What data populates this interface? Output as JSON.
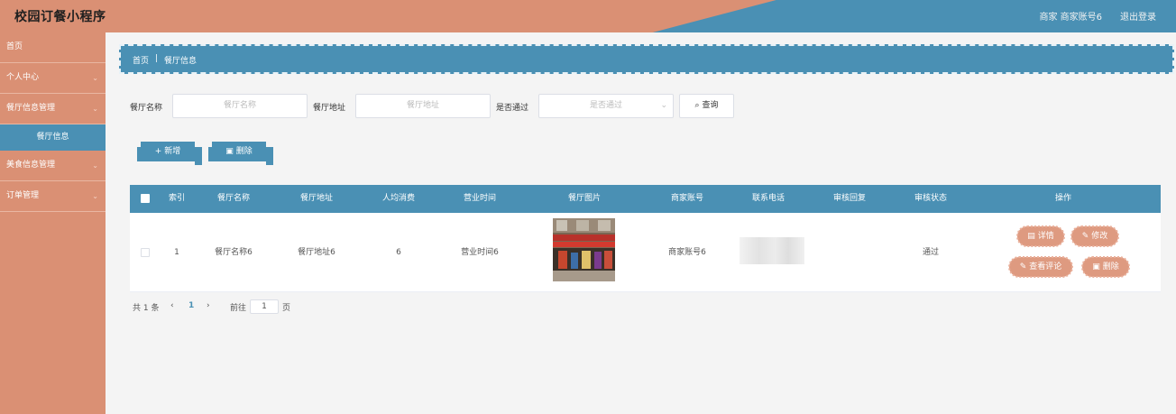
{
  "header": {
    "title": "校园订餐小程序",
    "user": "商家 商家账号6",
    "logout": "退出登录"
  },
  "sidebar": {
    "items": [
      {
        "label": "首页",
        "chevron": ""
      },
      {
        "label": "个人中心",
        "chevron": "⌄"
      },
      {
        "label": "餐厅信息管理",
        "chevron": "⌄"
      },
      {
        "label": "餐厅信息",
        "chevron": ""
      },
      {
        "label": "美食信息管理",
        "chevron": "⌄"
      },
      {
        "label": "订单管理",
        "chevron": "⌄"
      }
    ]
  },
  "breadcrumb": {
    "home": "首页",
    "separator": "|",
    "current": "餐厅信息"
  },
  "search": {
    "name_label": "餐厅名称",
    "name_placeholder": "餐厅名称",
    "address_label": "餐厅地址",
    "address_placeholder": "餐厅地址",
    "pass_label": "是否通过",
    "pass_placeholder": "是否通过",
    "query_label": "查询"
  },
  "actions": {
    "add_label": "新增",
    "delete_label": "删除"
  },
  "table": {
    "headers": [
      "索引",
      "餐厅名称",
      "餐厅地址",
      "人均消费",
      "营业时间",
      "餐厅图片",
      "商家账号",
      "联系电话",
      "审核回复",
      "审核状态",
      "操作"
    ],
    "rows": [
      {
        "index": "1",
        "name": "餐厅名称6",
        "address": "餐厅地址6",
        "avg_cost": "6",
        "hours": "营业时间6",
        "merchant": "商家账号6",
        "phone": "",
        "reply": "",
        "status": "通过",
        "ops": {
          "detail": "详情",
          "edit": "修改",
          "reviews": "查看评论",
          "delete": "删除"
        }
      }
    ]
  },
  "pager": {
    "total": "共 1 条",
    "prev": "‹",
    "current_page": "1",
    "next": "›",
    "goto": "前往",
    "page_value": "1",
    "page_unit": "页"
  },
  "colors": {
    "accent": "#4a90b4",
    "sidebar": "#da9074",
    "button_pink": "#de9a80"
  }
}
